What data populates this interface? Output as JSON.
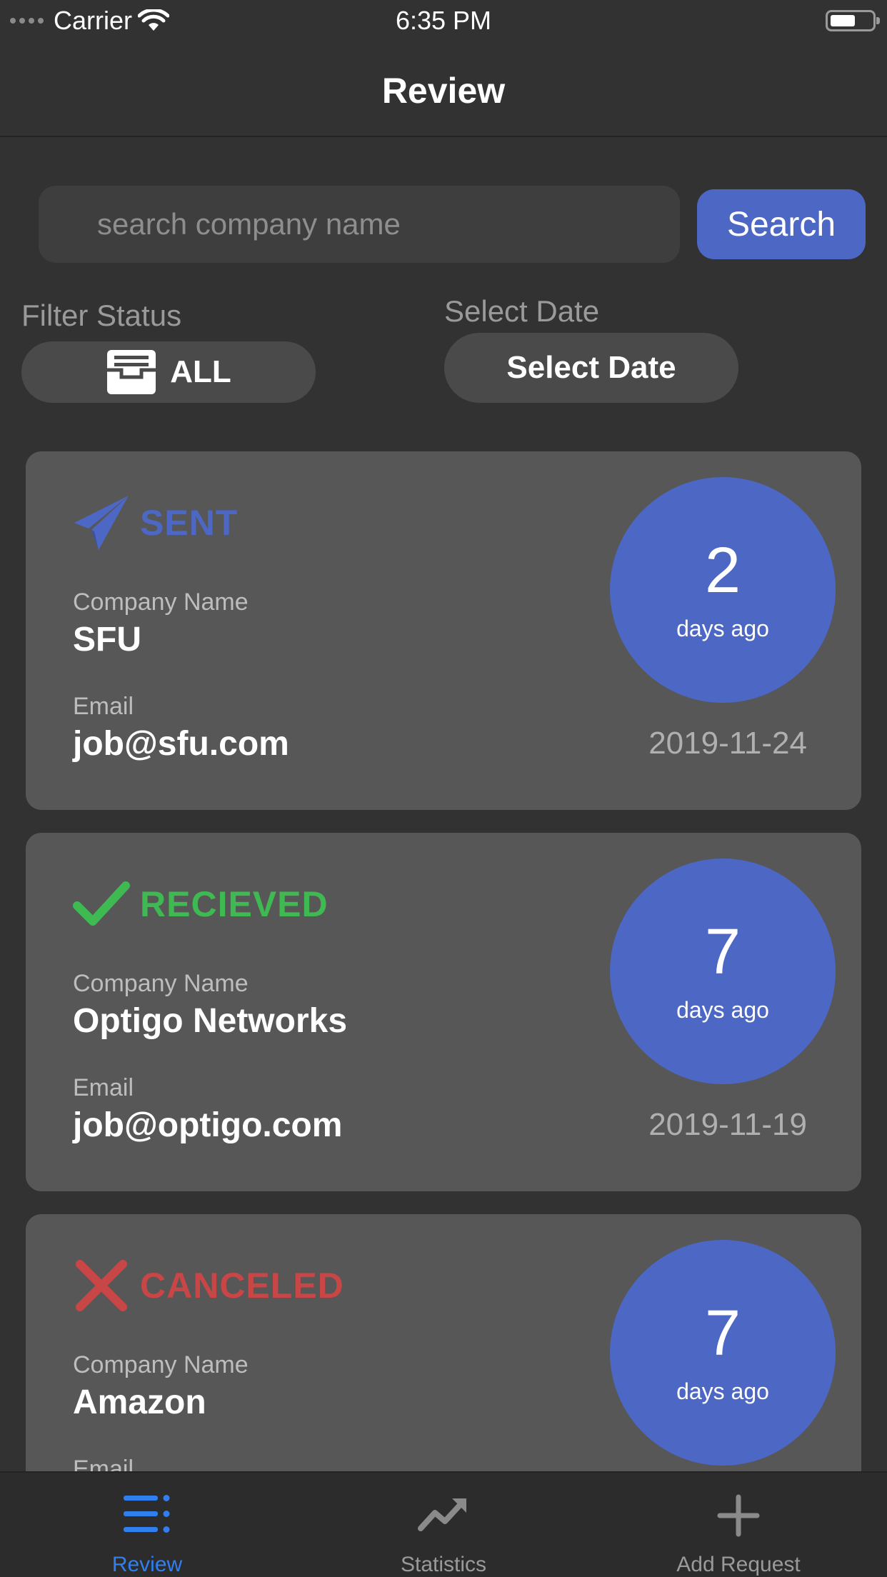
{
  "status_bar": {
    "carrier": "Carrier",
    "time": "6:35 PM"
  },
  "nav": {
    "title": "Review"
  },
  "search": {
    "placeholder": "search company name",
    "button_label": "Search"
  },
  "filters": {
    "status_label": "Filter Status",
    "status_value": "ALL",
    "date_label": "Select Date",
    "date_button": "Select Date"
  },
  "cards": [
    {
      "status": "SENT",
      "status_color": "#4d67c4",
      "status_icon": "paper-plane-icon",
      "company_label": "Company Name",
      "company": "SFU",
      "email_label": "Email",
      "email": "job@sfu.com",
      "days": "2",
      "days_label": "days ago",
      "date": "2019-11-24"
    },
    {
      "status": "RECIEVED",
      "status_color": "#3fb952",
      "status_icon": "checkmark-icon",
      "company_label": "Company Name",
      "company": "Optigo Networks",
      "email_label": "Email",
      "email": "job@optigo.com",
      "days": "7",
      "days_label": "days ago",
      "date": "2019-11-19"
    },
    {
      "status": "CANCELED",
      "status_color": "#c84646",
      "status_icon": "x-mark-icon",
      "company_label": "Company Name",
      "company": "Amazon",
      "email_label": "Email",
      "email": "",
      "days": "7",
      "days_label": "days ago",
      "date": ""
    }
  ],
  "tabs": [
    {
      "label": "Review",
      "icon": "list-icon",
      "active": true
    },
    {
      "label": "Statistics",
      "icon": "trend-icon",
      "active": false
    },
    {
      "label": "Add Request",
      "icon": "plus-icon",
      "active": false
    }
  ],
  "colors": {
    "accent": "#4d67c4",
    "tab_active": "#2f7ff0",
    "background": "#323232",
    "card": "#575757"
  }
}
